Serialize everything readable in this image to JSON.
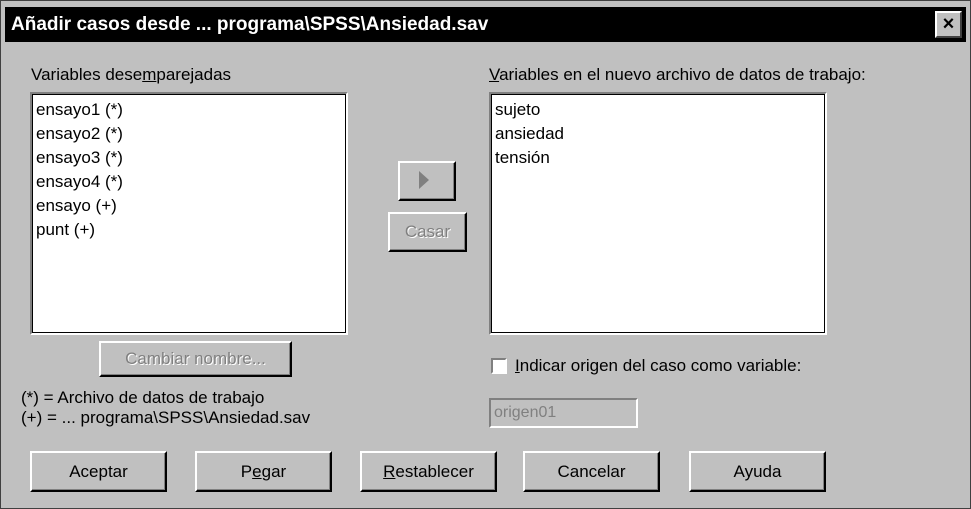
{
  "window": {
    "title": "Añadir casos desde ... programa\\SPSS\\Ansiedad.sav",
    "close_glyph": "×"
  },
  "unpaired": {
    "label_pre": "Variables dese",
    "label_mnemonic": "m",
    "label_post": "parejadas",
    "items": [
      "ensayo1 (*)",
      "ensayo2 (*)",
      "ensayo3 (*)",
      "ensayo4 (*)",
      "ensayo (+)",
      "punt (+)"
    ]
  },
  "newfile": {
    "label_mnemonic": "V",
    "label_post": "ariables en el nuevo archivo de datos de trabajo:",
    "items": [
      "sujeto",
      "ansiedad",
      "tensión"
    ]
  },
  "middle": {
    "pair_label": "Casar"
  },
  "rename": {
    "label": "Cambiar nombre..."
  },
  "legend": {
    "line1": "(*) = Archivo de datos de trabajo",
    "line2": "(+) = ... programa\\SPSS\\Ansiedad.sav"
  },
  "indicate": {
    "label_mnemonic": "I",
    "label_post": "ndicar origen del caso como variable:",
    "checked": false,
    "field_value": "origen01"
  },
  "buttons": {
    "ok": "Aceptar",
    "paste_pre": "P",
    "paste_mnemonic": "e",
    "paste_post": "gar",
    "reset_mnemonic": "R",
    "reset_post": "establecer",
    "cancel": "Cancelar",
    "help": "Ayuda"
  }
}
